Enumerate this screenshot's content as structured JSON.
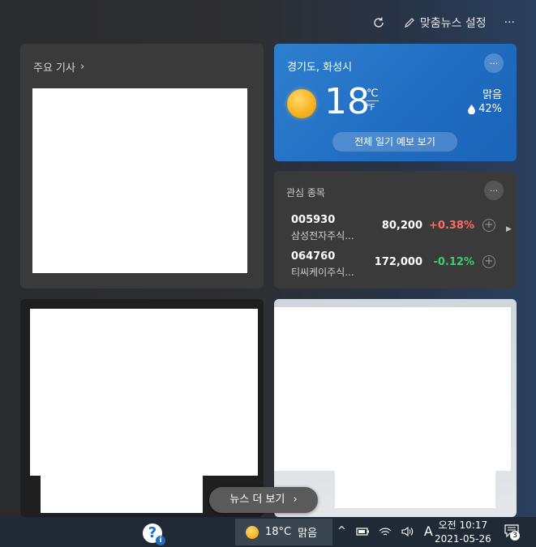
{
  "toolbar": {
    "refresh_icon": "refresh-icon",
    "personalize_label": "맞춤뉴스 설정",
    "more_label": "···"
  },
  "top_stories": {
    "header": "주요 기사",
    "chevron": "›"
  },
  "weather": {
    "location": "경기도, 화성시",
    "more_label": "···",
    "temperature": "18",
    "unit_c": "℃",
    "unit_f": "℉",
    "condition": "맑음",
    "humidity": "42%",
    "forecast_button": "전체 일기 예보 보기",
    "icon": "sunny-icon"
  },
  "stocks": {
    "title": "관심 종목",
    "more_label": "···",
    "rows": [
      {
        "code": "005930",
        "name": "삼성전자주식...",
        "price": "80,200",
        "change": "+0.38%",
        "change_color": "#ff6b5e"
      },
      {
        "code": "064760",
        "name": "티씨케이주식...",
        "price": "172,000",
        "change": "-0.12%",
        "change_color": "#3ccf6a"
      }
    ],
    "add_label": "+",
    "next_label": "▶"
  },
  "more_news": {
    "label": "뉴스 더 보기",
    "chevron": "›"
  },
  "taskbar": {
    "weather_temp": "18°C",
    "weather_cond": "맑음",
    "tray_chevron": "^",
    "ime_label": "A",
    "time": "오전 10:17",
    "date": "2021-05-26",
    "notification_count": "3",
    "help_label": "?",
    "help_badge": "i"
  }
}
